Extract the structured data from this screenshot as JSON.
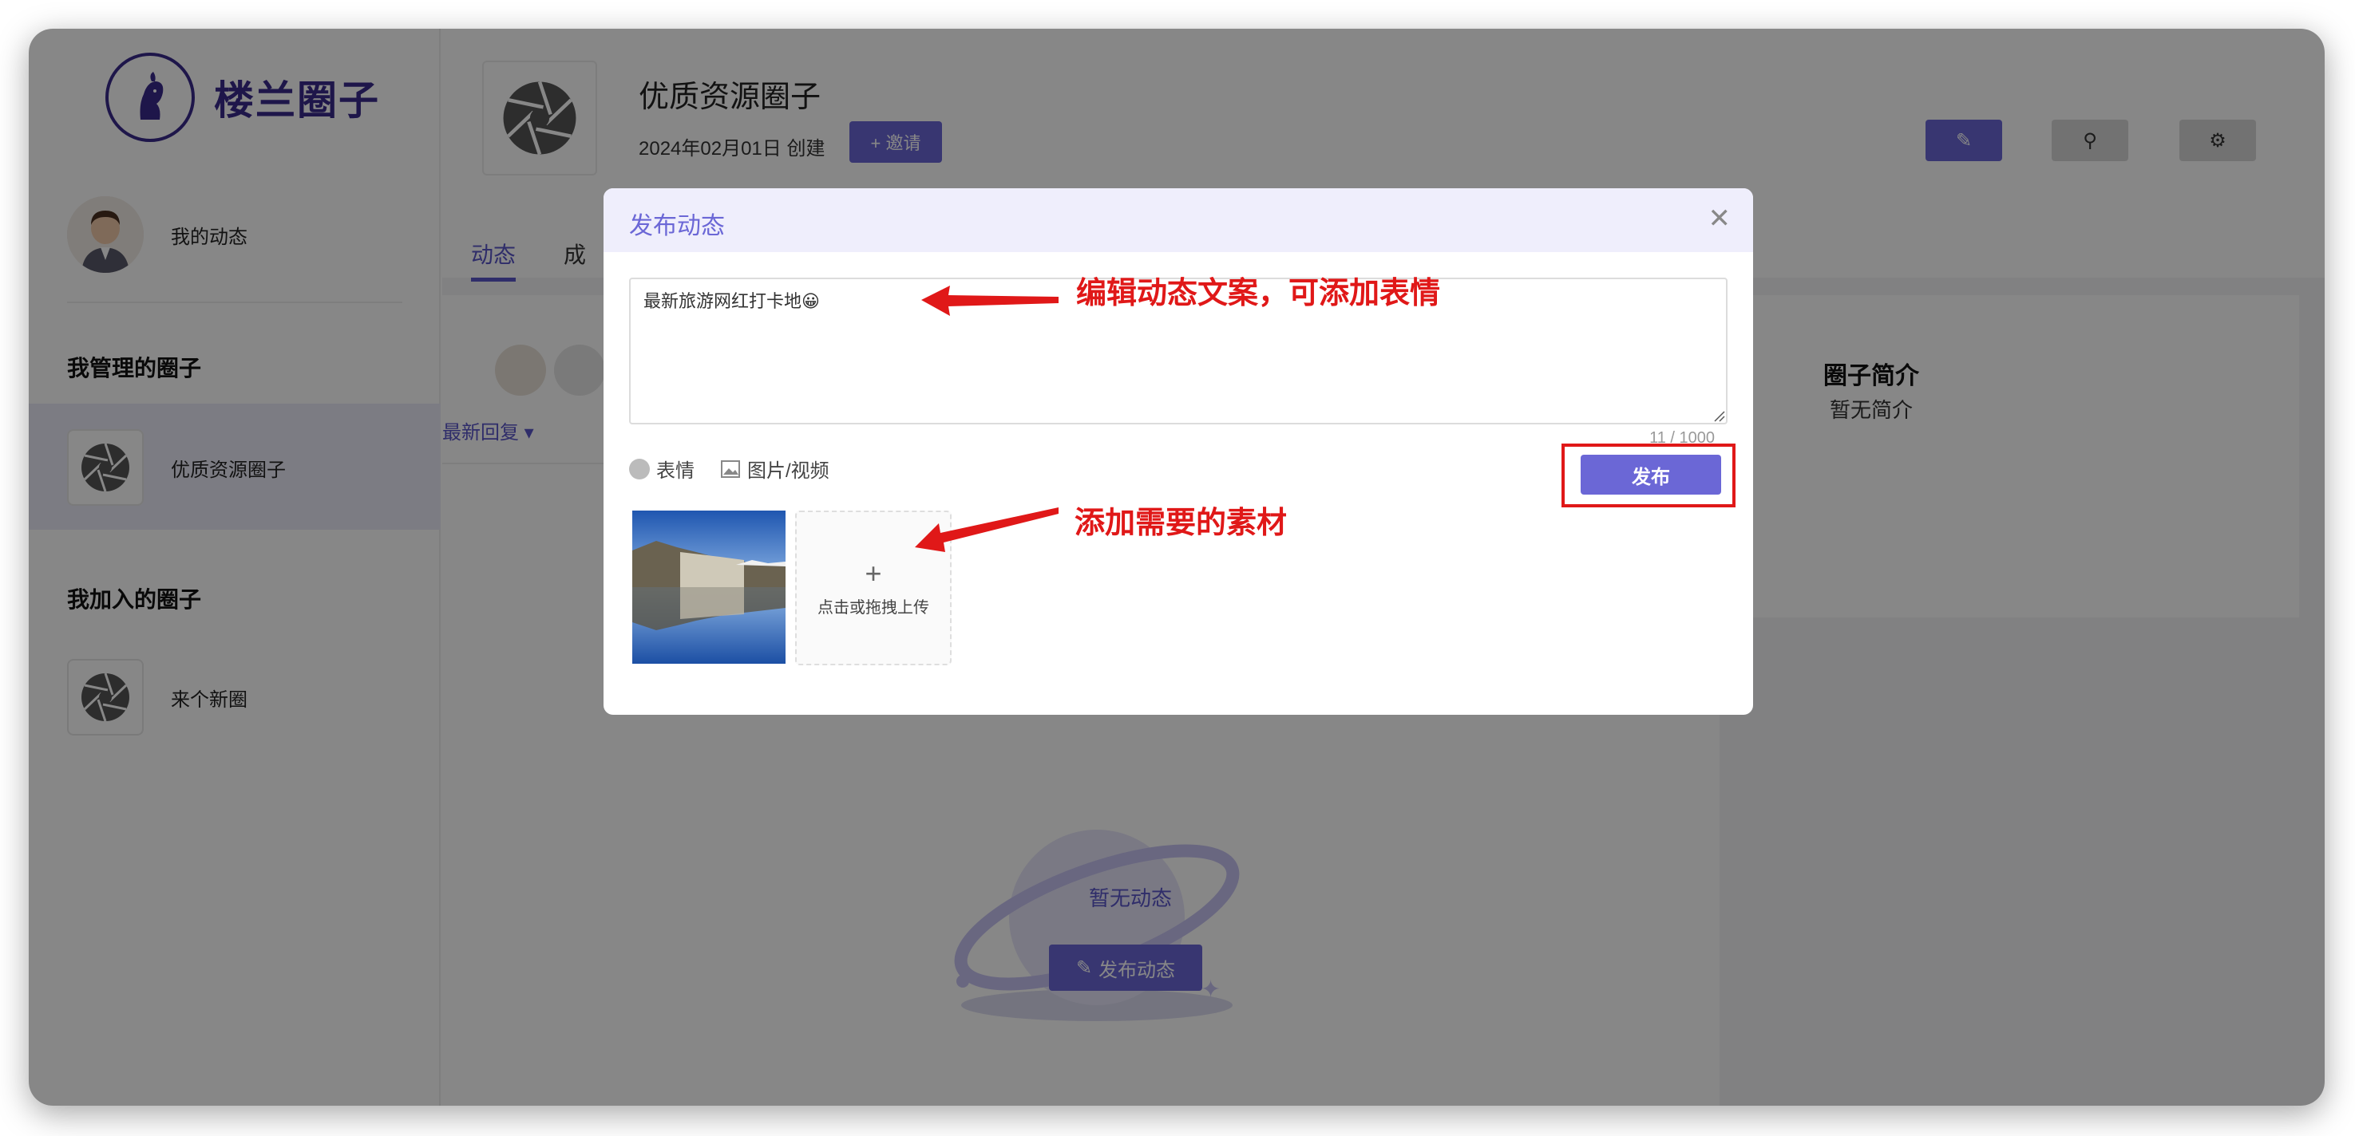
{
  "sidebar": {
    "brand": "楼兰圈子",
    "my_feed": "我的动态",
    "managed_heading": "我管理的圈子",
    "managed_items": [
      {
        "label": "优质资源圈子"
      }
    ],
    "joined_heading": "我加入的圈子",
    "joined_items": [
      {
        "label": "来个新圈"
      }
    ]
  },
  "header": {
    "title": "优质资源圈子",
    "created": "2024年02月01日 创建",
    "invite_label": "+ 邀请",
    "tools": [
      "feather-icon",
      "search-icon",
      "gear-icon"
    ]
  },
  "tabs": [
    {
      "label": "动态",
      "active": true
    },
    {
      "label": "成"
    }
  ],
  "feed": {
    "sort_label": "最新回复",
    "empty_text": "暂无动态",
    "publish_button": "发布动态"
  },
  "intro": {
    "title": "圈子简介",
    "body": "暂无简介"
  },
  "modal": {
    "title": "发布动态",
    "text_value": "最新旅游网红打卡地😀",
    "char_count": "11 / 1000",
    "emoji_label": "表情",
    "media_label": "图片/视频",
    "send_label": "发布",
    "upload_plus": "+",
    "upload_text": "点击或拖拽上传"
  },
  "annotations": {
    "edit_hint": "编辑动态文案，可添加表情",
    "material_hint": "添加需要的素材"
  },
  "colors": {
    "accent": "#6b67d6",
    "brand": "#3a2a8c",
    "annotation": "#e01818"
  }
}
